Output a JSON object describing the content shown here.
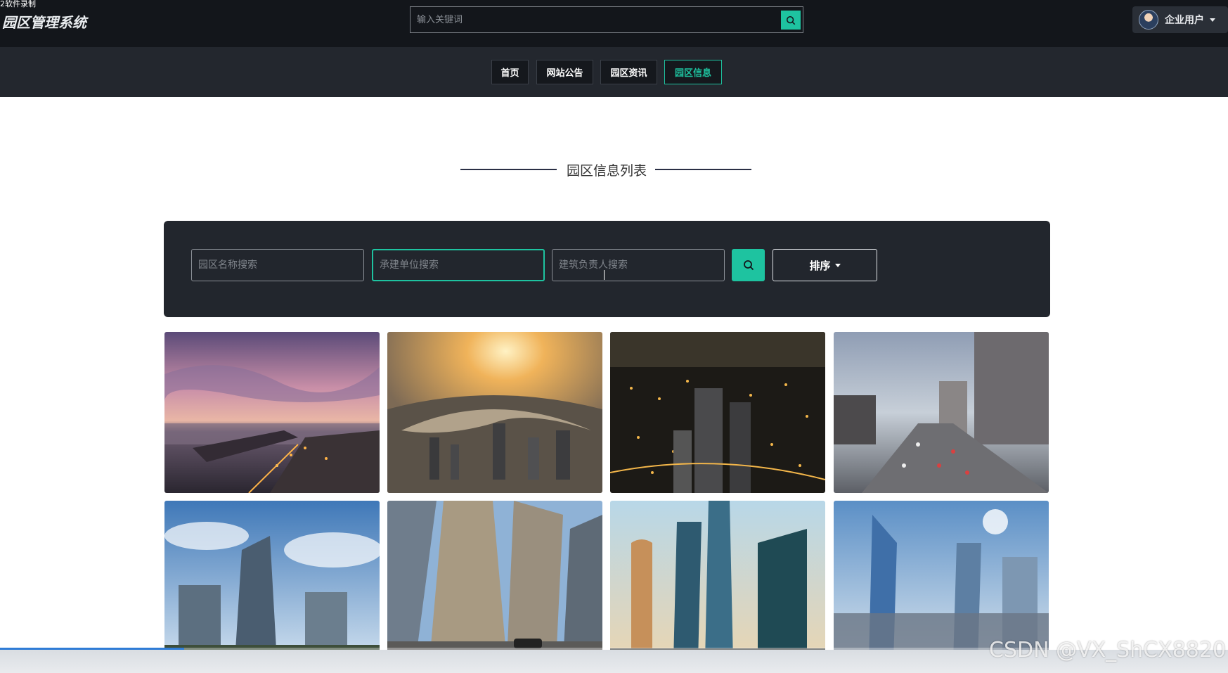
{
  "recorder_label": "2软件录制",
  "header": {
    "logo": "园区管理系统",
    "search_placeholder": "输入关键词",
    "user_name": "企业用户"
  },
  "nav": {
    "items": [
      {
        "label": "首页",
        "active": false
      },
      {
        "label": "网站公告",
        "active": false
      },
      {
        "label": "园区资讯",
        "active": false
      },
      {
        "label": "园区信息",
        "active": true
      }
    ]
  },
  "section": {
    "title": "园区信息列表"
  },
  "filters": {
    "park_name_placeholder": "园区名称搜索",
    "builder_placeholder": "承建单位搜索",
    "owner_placeholder": "建筑负责人搜索",
    "sort_label": "排序"
  },
  "cards": [
    {
      "scene": "sunset-harbor-city"
    },
    {
      "scene": "aerial-river-skyline"
    },
    {
      "scene": "night-city-lights"
    },
    {
      "scene": "urban-street-traffic"
    },
    {
      "scene": "glass-tower-clouds"
    },
    {
      "scene": "tall-office-buildings"
    },
    {
      "scene": "modern-skyscrapers"
    },
    {
      "scene": "blue-sky-towers"
    }
  ],
  "video": {
    "progress": 0.15
  },
  "watermark": "CSDN @VX_ShCX8820",
  "colors": {
    "accent": "#1ec3a0",
    "header_bg": "#13161b",
    "nav_bg": "#23272e",
    "panel_bg": "#22262d"
  }
}
